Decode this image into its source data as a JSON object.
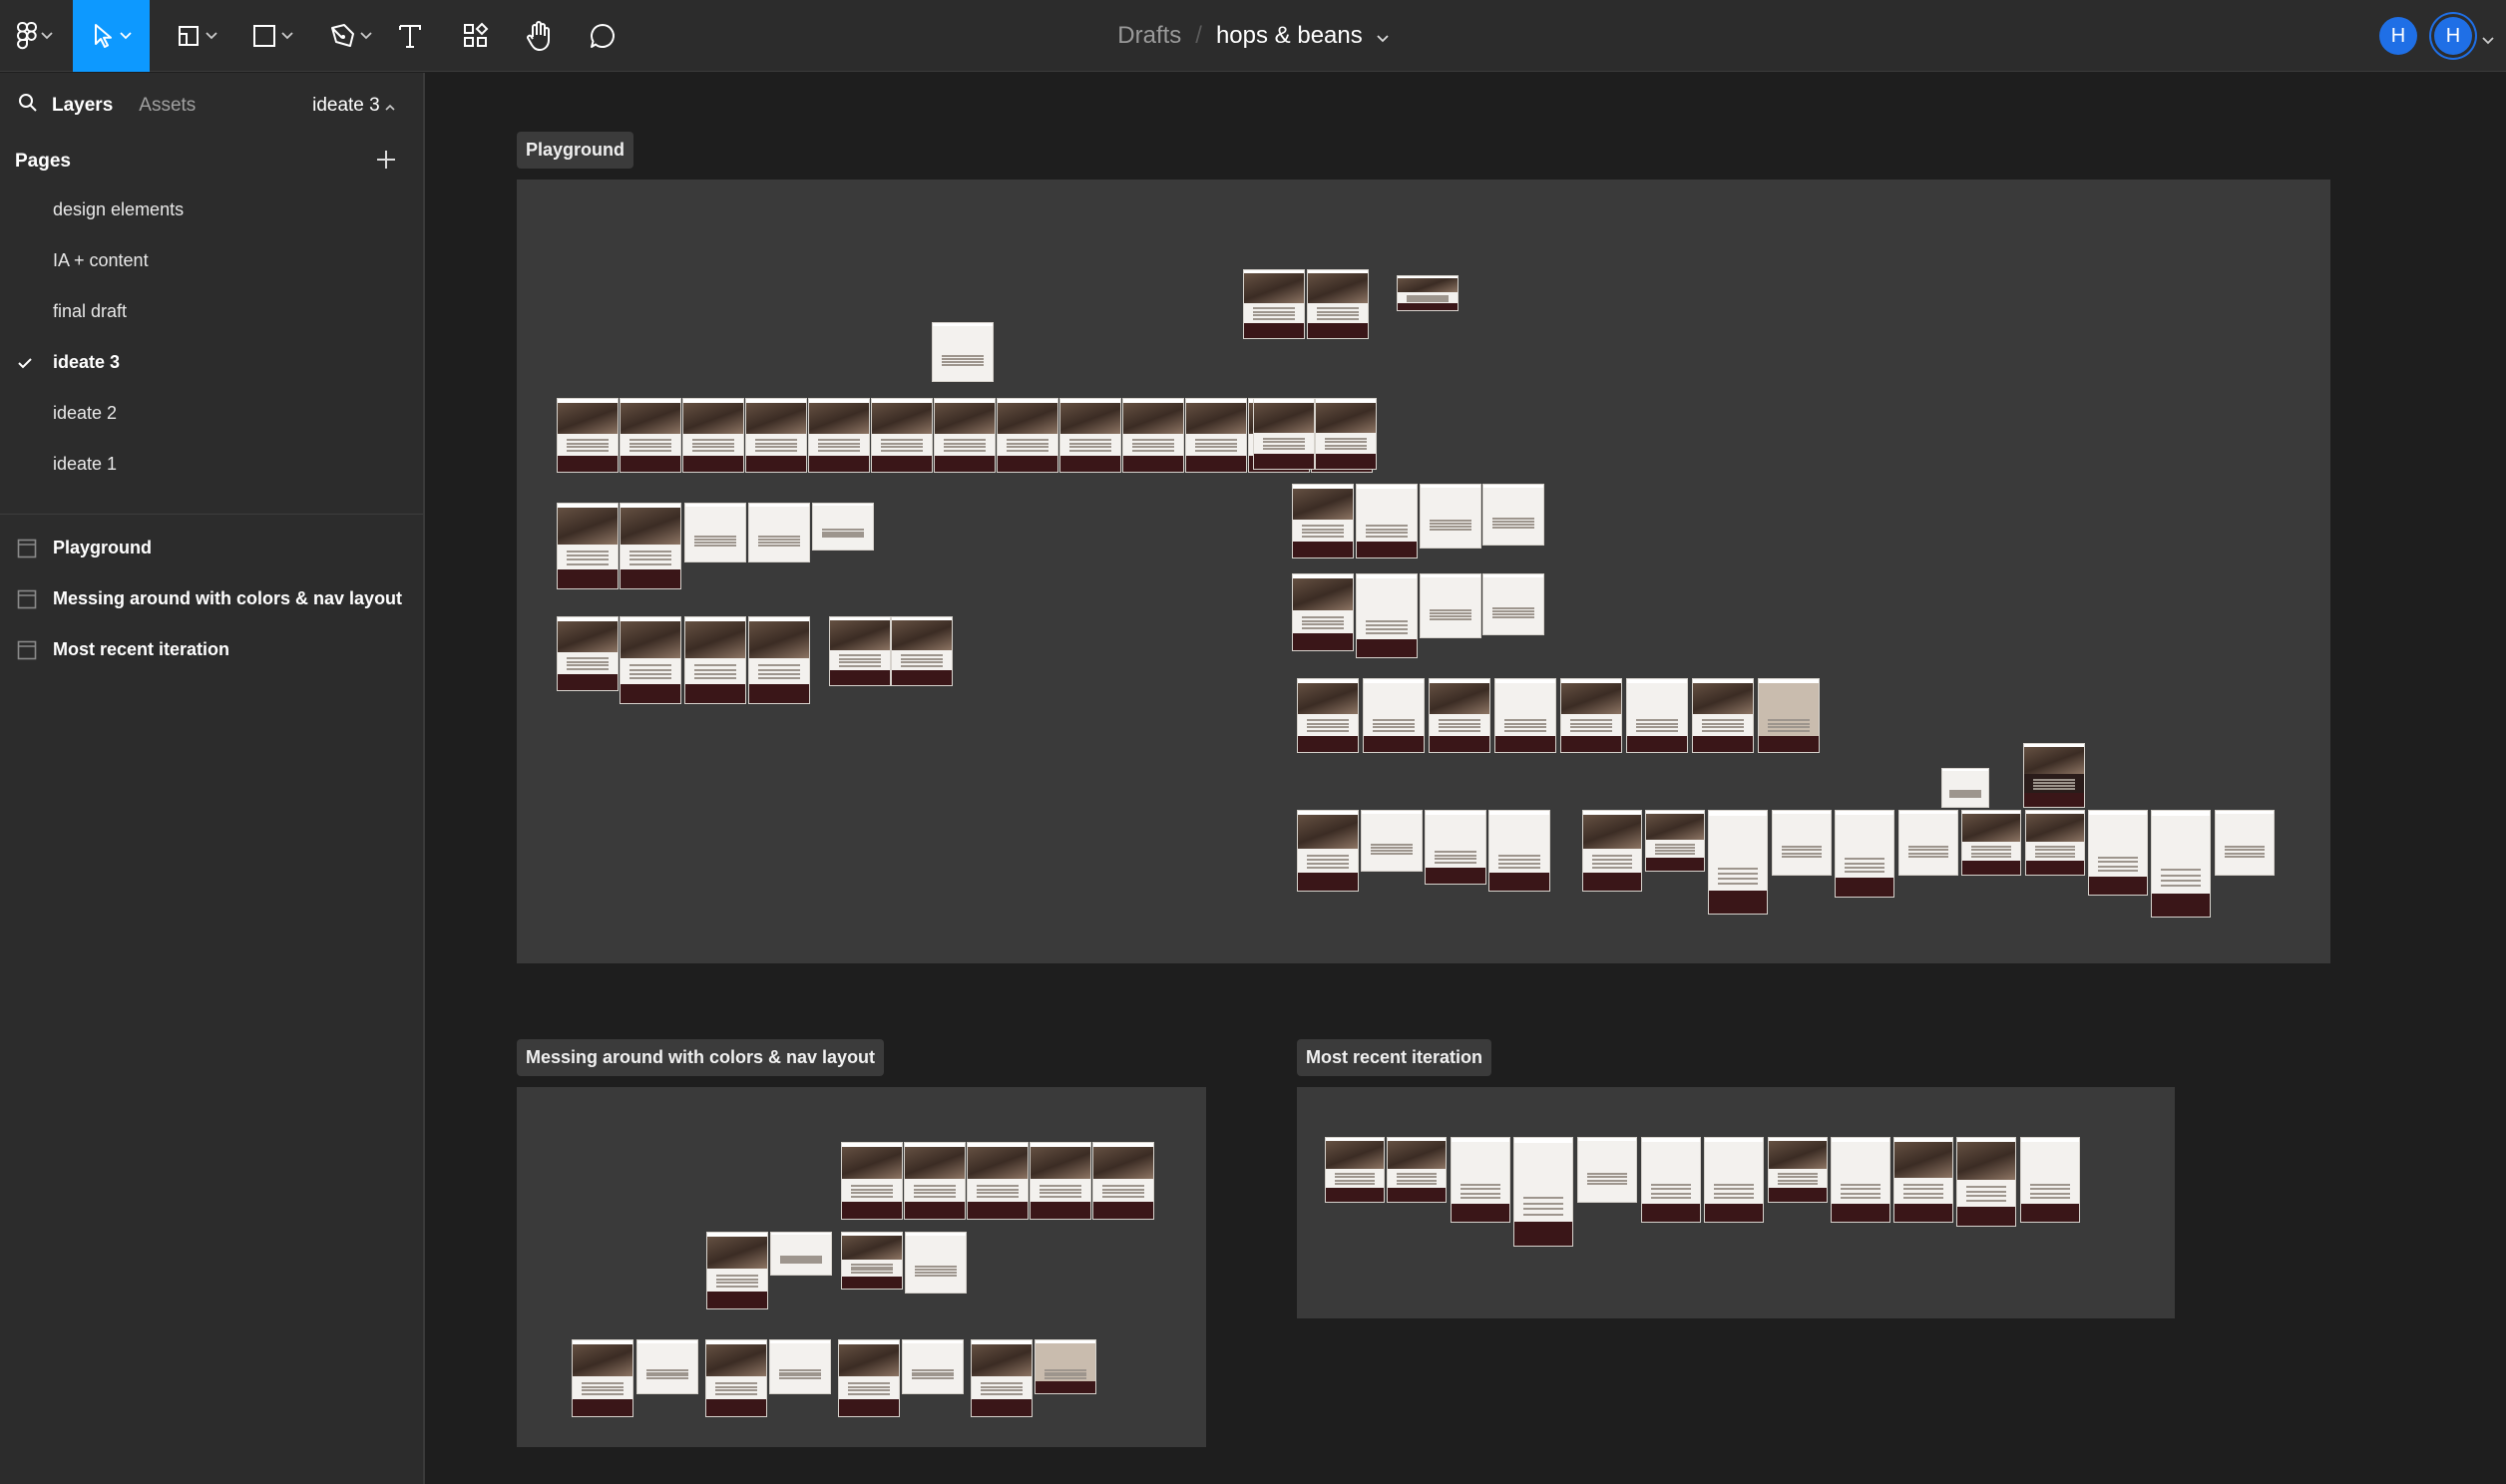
{
  "toolbar": {
    "tools": [
      {
        "name": "main-menu",
        "icon": "figma-logo-icon"
      },
      {
        "name": "move",
        "icon": "move-cursor-icon",
        "active": true
      },
      {
        "name": "frame",
        "icon": "frame-icon"
      },
      {
        "name": "shape",
        "icon": "rectangle-icon"
      },
      {
        "name": "pen",
        "icon": "pen-icon"
      },
      {
        "name": "text",
        "icon": "text-icon"
      },
      {
        "name": "resources",
        "icon": "components-icon"
      },
      {
        "name": "hand",
        "icon": "hand-icon"
      },
      {
        "name": "comment",
        "icon": "comment-icon"
      }
    ],
    "accent": "#0d99ff"
  },
  "breadcrumb": {
    "folder": "Drafts",
    "separator": "/",
    "file": "hops & beans"
  },
  "avatars": [
    {
      "initial": "H",
      "color": "#1f6fe6"
    },
    {
      "initial": "H",
      "color": "#1f6fe6"
    }
  ],
  "sidebar": {
    "tabs": {
      "layers": "Layers",
      "assets": "Assets"
    },
    "current_page": "ideate 3",
    "pages_title": "Pages",
    "pages": [
      {
        "label": "design elements"
      },
      {
        "label": "IA + content"
      },
      {
        "label": "final draft"
      },
      {
        "label": "ideate 3",
        "current": true
      },
      {
        "label": "ideate 2"
      },
      {
        "label": "ideate 1"
      }
    ],
    "layers": [
      {
        "label": "Playground"
      },
      {
        "label": "Messing around with colors & nav layout"
      },
      {
        "label": "Most recent iteration"
      }
    ]
  },
  "canvas": {
    "frames": [
      {
        "label": "Playground"
      },
      {
        "label": "Messing around with colors & nav layout"
      },
      {
        "label": "Most recent iteration"
      }
    ],
    "background": "#1e1e1e",
    "frame_fill": "#3a3a3a"
  }
}
